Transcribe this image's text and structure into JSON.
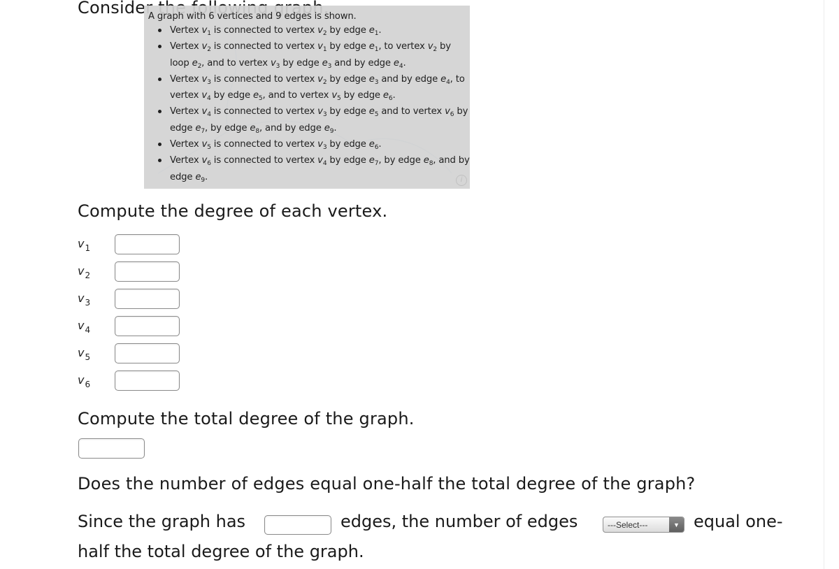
{
  "intro": {
    "heading": "Consider the following graph."
  },
  "graph_alt": {
    "summary": "A graph with 6 vertices and 9 edges is shown.",
    "items": [
      "Vertex v1 is connected to vertex v2 by edge e1.",
      "Vertex v2 is connected to vertex v1 by edge e1, to vertex v2 by loop e2, and to vertex v3 by edge e3 and by edge e4.",
      "Vertex v3 is connected to vertex v2 by edge e3 and by edge e4, to vertex v4 by edge e5, and to vertex v5 by edge e6.",
      "Vertex v4 is connected to vertex v3 by edge e5 and to vertex v6 by edge e7, by edge e8, and by edge e9.",
      "Vertex v5 is connected to vertex v3 by edge e6.",
      "Vertex v6 is connected to vertex v4 by edge e7, by edge e8, and by edge e9."
    ],
    "info_icon": "info-circle-icon"
  },
  "degree_section": {
    "heading": "Compute the degree of each vertex.",
    "vertices": [
      {
        "name": "v",
        "sub": "1",
        "value": ""
      },
      {
        "name": "v",
        "sub": "2",
        "value": ""
      },
      {
        "name": "v",
        "sub": "3",
        "value": ""
      },
      {
        "name": "v",
        "sub": "4",
        "value": ""
      },
      {
        "name": "v",
        "sub": "5",
        "value": ""
      },
      {
        "name": "v",
        "sub": "6",
        "value": ""
      }
    ]
  },
  "total_section": {
    "heading": "Compute the total degree of the graph.",
    "value": ""
  },
  "question_section": {
    "heading": "Does the number of edges equal one-half the total degree of the graph?",
    "part1": "Since the graph has",
    "edges_value": "",
    "part2": "edges, the number of edges",
    "select_value": "---Select---",
    "select_arrow": "▼",
    "part3": "equal one-",
    "line2": "half the total degree of the graph."
  }
}
